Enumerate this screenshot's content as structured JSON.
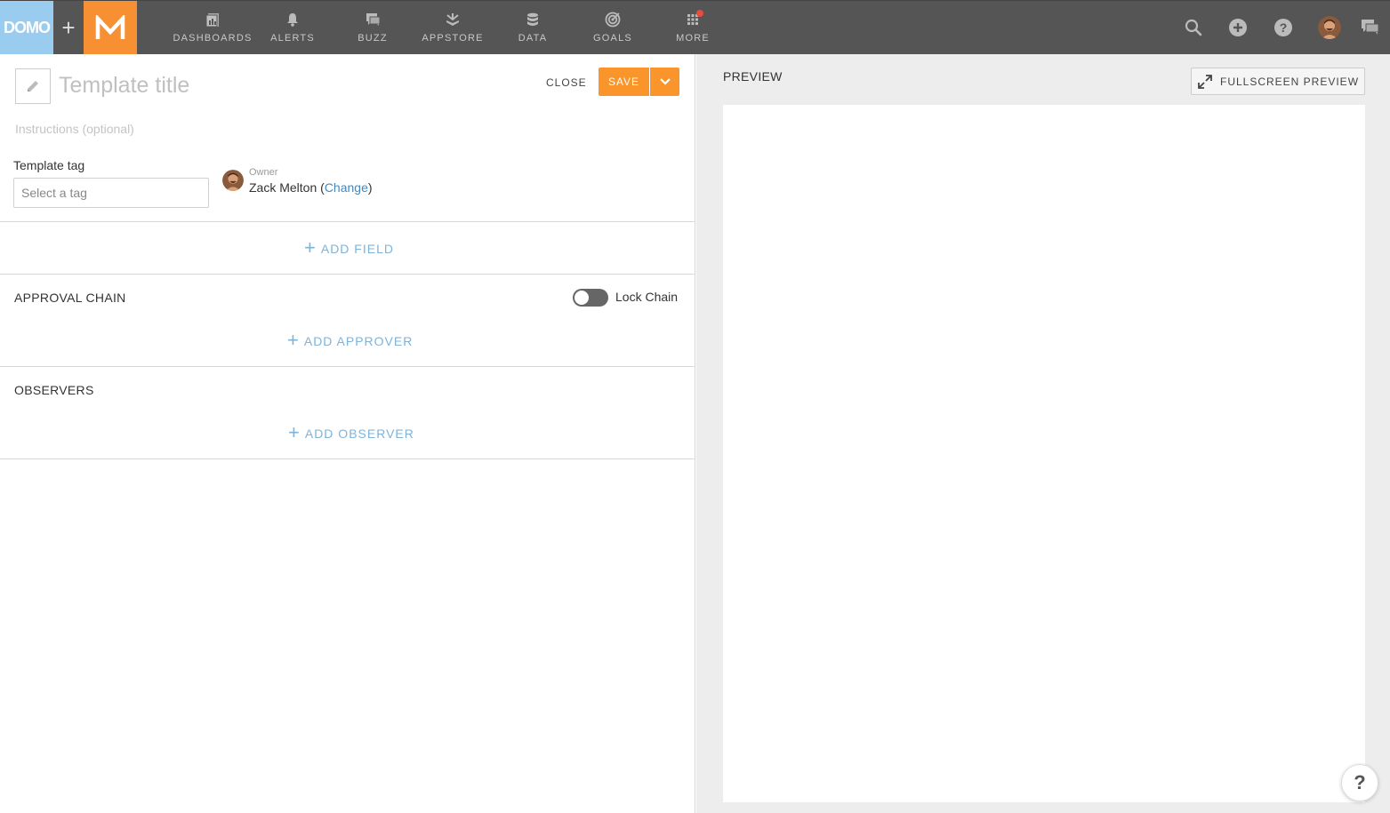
{
  "topbar": {
    "domo_logo": "DOMO",
    "nav": [
      {
        "label": "DASHBOARDS",
        "icon": "dashboards-icon"
      },
      {
        "label": "ALERTS",
        "icon": "bell-icon"
      },
      {
        "label": "BUZZ",
        "icon": "chat-icon"
      },
      {
        "label": "APPSTORE",
        "icon": "appstore-icon"
      },
      {
        "label": "DATA",
        "icon": "database-icon"
      },
      {
        "label": "GOALS",
        "icon": "target-icon"
      },
      {
        "label": "MORE",
        "icon": "grid-icon"
      }
    ]
  },
  "form": {
    "title_placeholder": "Template title",
    "close_label": "CLOSE",
    "save_label": "SAVE",
    "instructions_placeholder": "Instructions (optional)",
    "tag_label": "Template tag",
    "tag_placeholder": "Select a tag",
    "owner_label": "Owner",
    "owner_name": "Zack Melton",
    "owner_change": "Change",
    "add_field": "ADD FIELD",
    "approval_title": "APPROVAL CHAIN",
    "lock_chain_label": "Lock Chain",
    "add_approver": "ADD APPROVER",
    "observers_title": "OBSERVERS",
    "add_observer": "ADD OBSERVER"
  },
  "preview": {
    "label": "PREVIEW",
    "fullscreen_label": "FULLSCREEN PREVIEW",
    "help_glyph": "?"
  },
  "colors": {
    "topbar": "#555555",
    "domo_logo_bg": "#99ccee",
    "brand_orange": "#f78f33",
    "link_blue": "#3f89c5",
    "add_link": "#7fb3d8"
  }
}
